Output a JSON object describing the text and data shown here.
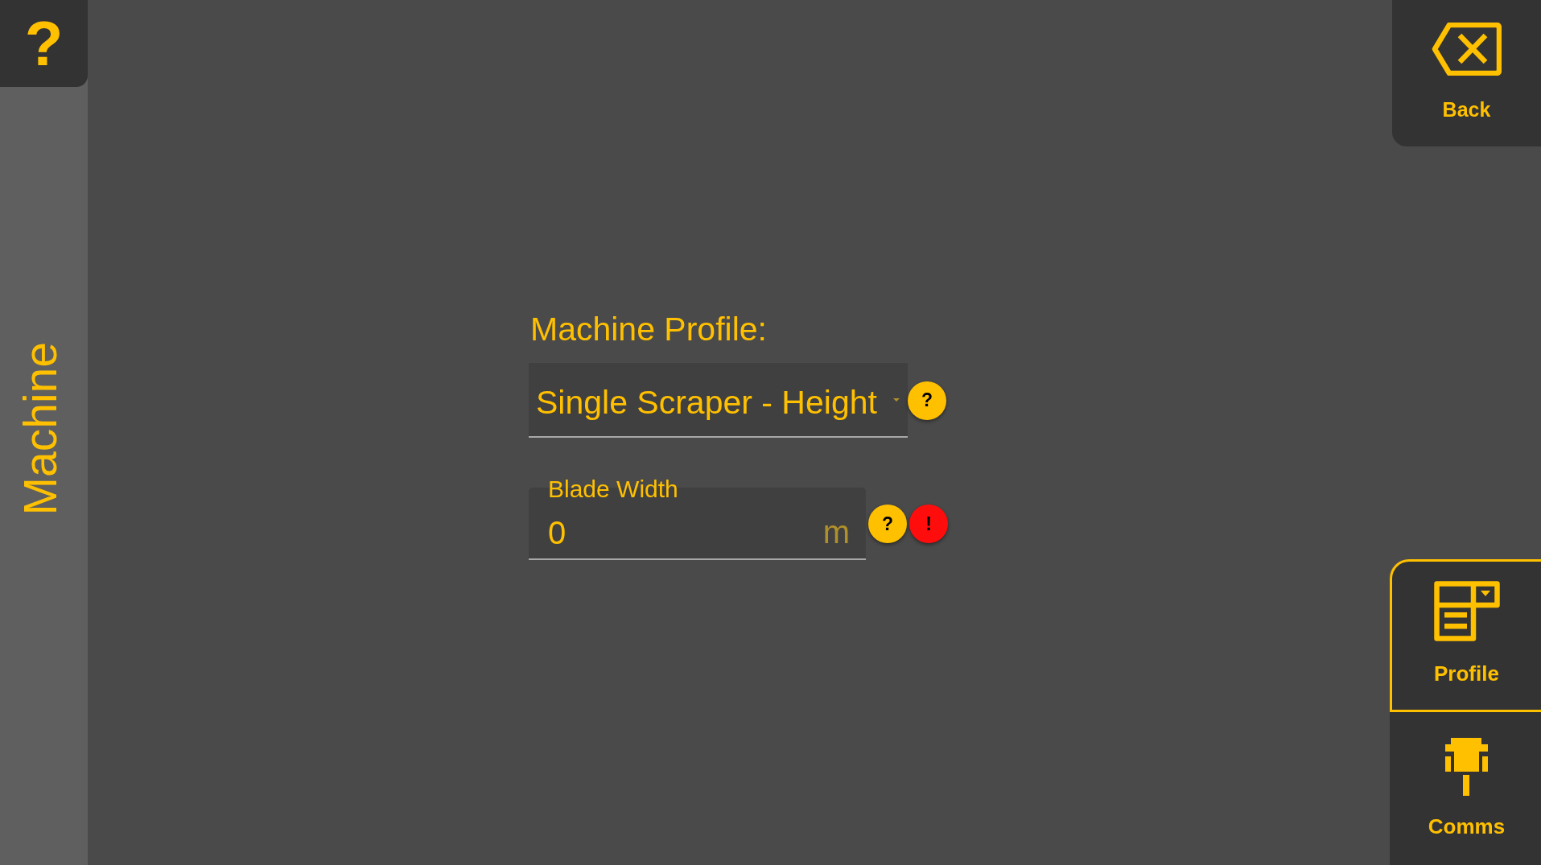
{
  "help_button": {
    "label": "?"
  },
  "sidebar": {
    "title": "Machine"
  },
  "form": {
    "profile": {
      "label": "Machine Profile:",
      "value": "Single Scraper - Height",
      "help": "?"
    },
    "blade_width": {
      "label": "Blade Width",
      "value": "0",
      "unit": "m",
      "help": "?",
      "alert": "!"
    }
  },
  "back_button": {
    "label": "Back"
  },
  "tabs": [
    {
      "label": "Profile",
      "selected": true
    },
    {
      "label": "Comms",
      "selected": false
    }
  ]
}
